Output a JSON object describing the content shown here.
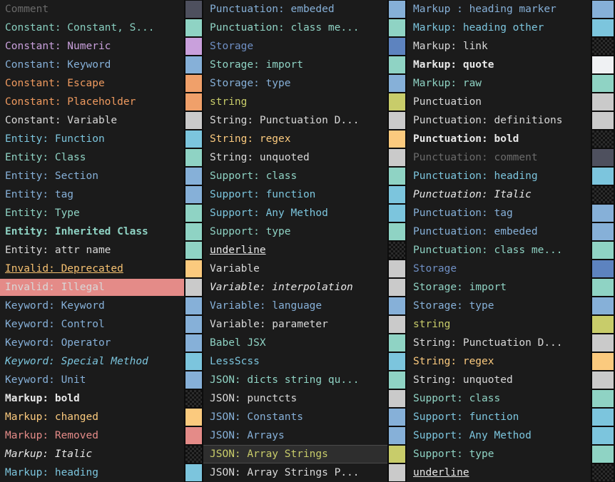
{
  "window": {
    "title": "Color Scheme Preview",
    "background": "#1b1b1b",
    "swatch_border": "#0d0d0d"
  },
  "legend": {
    "checker_meaning": "no color set",
    "selected_row_background": "#2e2e2e",
    "illegal_row_background": "#e48b88"
  },
  "columns": [
    {
      "name": "column-1",
      "rows": [
        {
          "label": "Comment",
          "color": "#6b6b6b",
          "swatch": "#4e505e",
          "style": ""
        },
        {
          "label": "Constant: Constant, S...",
          "color": "#88cfc0",
          "swatch": "#8fd3c4",
          "style": ""
        },
        {
          "label": "Constant: Numeric",
          "color": "#c9a0dc",
          "swatch": "#c9a0dc",
          "style": ""
        },
        {
          "label": "Constant: Keyword",
          "color": "#86b0d8",
          "swatch": "#86b0d8",
          "style": ""
        },
        {
          "label": "Constant: Escape",
          "color": "#ef9a5f",
          "swatch": "#f0a06a",
          "style": ""
        },
        {
          "label": "Constant: Placeholder",
          "color": "#ef9a5f",
          "swatch": "#f0a06a",
          "style": ""
        },
        {
          "label": "Constant: Variable",
          "color": "#d8d8d8",
          "swatch": "#cacaca",
          "style": ""
        },
        {
          "label": "Entity: Function",
          "color": "#7cc5dd",
          "swatch": "#7cc5dd",
          "style": ""
        },
        {
          "label": "Entity: Class",
          "color": "#8fd3c4",
          "swatch": "#8fd3c4",
          "style": ""
        },
        {
          "label": "Entity: Section",
          "color": "#86b0d8",
          "swatch": "#86b0d8",
          "style": ""
        },
        {
          "label": "Entity: tag",
          "color": "#86b0d8",
          "swatch": "#86b0d8",
          "style": ""
        },
        {
          "label": "Entity: Type",
          "color": "#8fd3c4",
          "swatch": "#8fd3c4",
          "style": ""
        },
        {
          "label": "Entity: Inherited Class",
          "color": "#8fd3c4",
          "swatch": "#8fd3c4",
          "style": "b"
        },
        {
          "label": "Entity: attr name",
          "color": "#d8d8d8",
          "swatch": "#8fd3c4",
          "style": ""
        },
        {
          "label": "Invalid: Deprecated",
          "color": "#f6c171",
          "swatch": "#fbca7e",
          "style": "u"
        },
        {
          "label": "Invalid: Illegal",
          "color": "#d8d8d8",
          "swatch": "#cacaca",
          "style": "",
          "row_background": "#e48b88"
        },
        {
          "label": "Keyword: Keyword",
          "color": "#86b0d8",
          "swatch": "#86b0d8",
          "style": ""
        },
        {
          "label": "Keyword: Control",
          "color": "#86b0d8",
          "swatch": "#86b0d8",
          "style": ""
        },
        {
          "label": "Keyword: Operator",
          "color": "#86b0d8",
          "swatch": "#86b0d8",
          "style": ""
        },
        {
          "label": "Keyword: Special Method",
          "color": "#7cc5dd",
          "swatch": "#7cc5dd",
          "style": "i"
        },
        {
          "label": "Keyword: Unit",
          "color": "#86b0d8",
          "swatch": "#86b0d8",
          "style": ""
        },
        {
          "label": "Markup: bold",
          "color": "#e8e8e8",
          "swatch": "checker",
          "style": "b"
        },
        {
          "label": "Markup: changed",
          "color": "#fbca7e",
          "swatch": "#fbca7e",
          "style": ""
        },
        {
          "label": "Markup: Removed",
          "color": "#e48b88",
          "swatch": "#e48b88",
          "style": ""
        },
        {
          "label": "Markup: Italic",
          "color": "#e8e8e8",
          "swatch": "checker",
          "style": "i"
        },
        {
          "label": "Markup: heading",
          "color": "#7cc5dd",
          "swatch": "#7cc5dd",
          "style": ""
        }
      ]
    },
    {
      "name": "column-2",
      "rows": [
        {
          "label": "Punctuation: embeded",
          "color": "#86b0d8",
          "swatch": "#86b0d8",
          "style": ""
        },
        {
          "label": "Punctuation: class me...",
          "color": "#8fd3c4",
          "swatch": "#8fd3c4",
          "style": ""
        },
        {
          "label": "Storage",
          "color": "#6f8fc4",
          "swatch": "#5d83bf",
          "style": ""
        },
        {
          "label": "Storage: import",
          "color": "#8fd3c4",
          "swatch": "#8fd3c4",
          "style": ""
        },
        {
          "label": "Storage: type",
          "color": "#86b0d8",
          "swatch": "#86b0d8",
          "style": ""
        },
        {
          "label": "string",
          "color": "#c8cc6a",
          "swatch": "#c8cc6a",
          "style": ""
        },
        {
          "label": "String: Punctuation D...",
          "color": "#d8d8d8",
          "swatch": "#cacaca",
          "style": ""
        },
        {
          "label": "String: regex",
          "color": "#fbca7e",
          "swatch": "#fbca7e",
          "style": ""
        },
        {
          "label": "String: unquoted",
          "color": "#d8d8d8",
          "swatch": "#cacaca",
          "style": ""
        },
        {
          "label": "Support: class",
          "color": "#8fd3c4",
          "swatch": "#8fd3c4",
          "style": ""
        },
        {
          "label": "Support: function",
          "color": "#7cc5dd",
          "swatch": "#7cc5dd",
          "style": ""
        },
        {
          "label": "Support: Any Method",
          "color": "#7cc5dd",
          "swatch": "#7cc5dd",
          "style": ""
        },
        {
          "label": "Support: type",
          "color": "#8fd3c4",
          "swatch": "#8fd3c4",
          "style": ""
        },
        {
          "label": "underline",
          "color": "#e8e8e8",
          "swatch": "checker",
          "style": "u"
        },
        {
          "label": "Variable",
          "color": "#d8d8d8",
          "swatch": "#cacaca",
          "style": ""
        },
        {
          "label": "Variable: interpolation",
          "color": "#e8e8e8",
          "swatch": "#cacaca",
          "style": "i"
        },
        {
          "label": "Variable: language",
          "color": "#86b0d8",
          "swatch": "#86b0d8",
          "style": ""
        },
        {
          "label": "Variable: parameter",
          "color": "#d8d8d8",
          "swatch": "#cacaca",
          "style": ""
        },
        {
          "label": "Babel JSX",
          "color": "#8fd3c4",
          "swatch": "#8fd3c4",
          "style": ""
        },
        {
          "label": "LessScss",
          "color": "#7cc5dd",
          "swatch": "#7cc5dd",
          "style": ""
        },
        {
          "label": "JSON: dicts string qu...",
          "color": "#8fd3c4",
          "swatch": "#8fd3c4",
          "style": ""
        },
        {
          "label": "JSON: punctcts",
          "color": "#d8d8d8",
          "swatch": "#cacaca",
          "style": ""
        },
        {
          "label": "JSON: Constants",
          "color": "#86b0d8",
          "swatch": "#86b0d8",
          "style": ""
        },
        {
          "label": "JSON: Arrays",
          "color": "#86b0d8",
          "swatch": "#86b0d8",
          "style": ""
        },
        {
          "label": "JSON: Array Strings",
          "color": "#c8cc6a",
          "swatch": "#c8cc6a",
          "style": "",
          "selected": true
        },
        {
          "label": "JSON: Array Strings P...",
          "color": "#d8d8d8",
          "swatch": "#cacaca",
          "style": ""
        }
      ]
    },
    {
      "name": "column-3",
      "rows": [
        {
          "label": "Markup : heading marker",
          "color": "#86b0d8",
          "swatch": "#86b0d8",
          "style": ""
        },
        {
          "label": "Markup: heading other",
          "color": "#7cc5dd",
          "swatch": "#7cc5dd",
          "style": ""
        },
        {
          "label": "Markup: link",
          "color": "#d8d8d8",
          "swatch": "checker",
          "style": ""
        },
        {
          "label": "Markup: quote",
          "color": "#e8e8e8",
          "swatch": "#eff1f3",
          "style": "b"
        },
        {
          "label": "Markup: raw",
          "color": "#8fd3c4",
          "swatch": "#8fd3c4",
          "style": ""
        },
        {
          "label": "Punctuation",
          "color": "#d8d8d8",
          "swatch": "#cacaca",
          "style": ""
        },
        {
          "label": "Punctuation: definitions",
          "color": "#d8d8d8",
          "swatch": "#cacaca",
          "style": ""
        },
        {
          "label": "Punctuation: bold",
          "color": "#e8e8e8",
          "swatch": "checker",
          "style": "b"
        },
        {
          "label": "Punctuation: comment",
          "color": "#6b6b6b",
          "swatch": "#4e505e",
          "style": ""
        },
        {
          "label": "Punctuation: heading",
          "color": "#7cc5dd",
          "swatch": "#7cc5dd",
          "style": ""
        },
        {
          "label": "Punctuation: Italic",
          "color": "#e8e8e8",
          "swatch": "checker",
          "style": "i"
        },
        {
          "label": "Punctuation: tag",
          "color": "#86b0d8",
          "swatch": "#86b0d8",
          "style": ""
        },
        {
          "label": "Punctuation: embeded",
          "color": "#86b0d8",
          "swatch": "#86b0d8",
          "style": ""
        },
        {
          "label": "Punctuation: class me...",
          "color": "#8fd3c4",
          "swatch": "#8fd3c4",
          "style": ""
        },
        {
          "label": "Storage",
          "color": "#6f8fc4",
          "swatch": "#5d83bf",
          "style": ""
        },
        {
          "label": "Storage: import",
          "color": "#8fd3c4",
          "swatch": "#8fd3c4",
          "style": ""
        },
        {
          "label": "Storage: type",
          "color": "#86b0d8",
          "swatch": "#86b0d8",
          "style": ""
        },
        {
          "label": "string",
          "color": "#c8cc6a",
          "swatch": "#c8cc6a",
          "style": ""
        },
        {
          "label": "String: Punctuation D...",
          "color": "#d8d8d8",
          "swatch": "#cacaca",
          "style": ""
        },
        {
          "label": "String: regex",
          "color": "#fbca7e",
          "swatch": "#fbca7e",
          "style": ""
        },
        {
          "label": "String: unquoted",
          "color": "#d8d8d8",
          "swatch": "#cacaca",
          "style": ""
        },
        {
          "label": "Support: class",
          "color": "#8fd3c4",
          "swatch": "#8fd3c4",
          "style": ""
        },
        {
          "label": "Support: function",
          "color": "#7cc5dd",
          "swatch": "#7cc5dd",
          "style": ""
        },
        {
          "label": "Support: Any Method",
          "color": "#7cc5dd",
          "swatch": "#7cc5dd",
          "style": ""
        },
        {
          "label": "Support: type",
          "color": "#8fd3c4",
          "swatch": "#8fd3c4",
          "style": ""
        },
        {
          "label": "underline",
          "color": "#e8e8e8",
          "swatch": "checker",
          "style": "u"
        }
      ]
    }
  ]
}
